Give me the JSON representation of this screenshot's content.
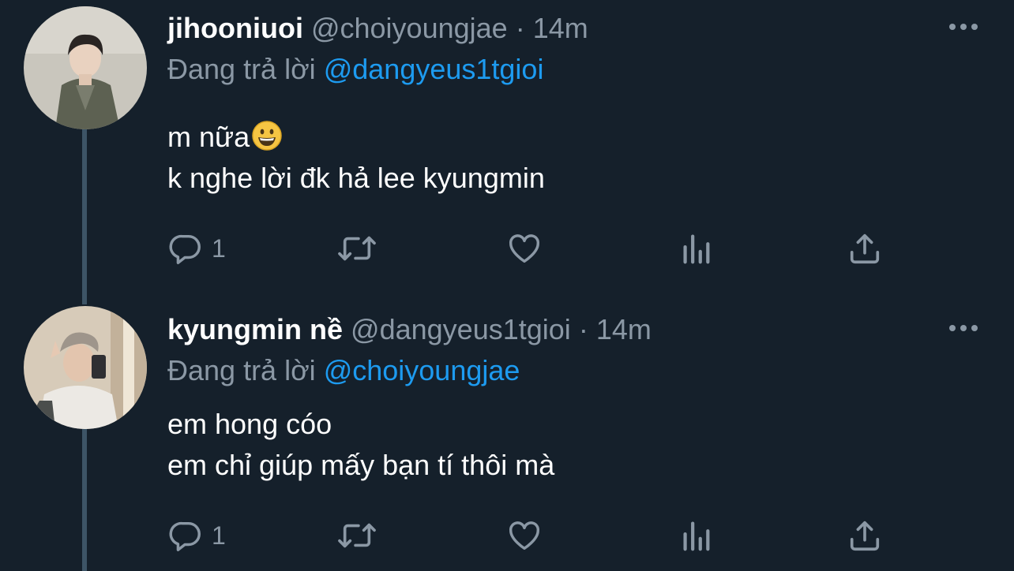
{
  "tweets": [
    {
      "name": "jihooniuoi",
      "handle": "@choiyoungjae",
      "separator": "·",
      "time": "14m",
      "replying_label": "Đang trả lời",
      "replying_to": "@dangyeus1tgioi",
      "body_lines": [
        "m nữa",
        "k nghe lời đk hả lee kyungmin"
      ],
      "reply_count": "1"
    },
    {
      "name": "kyungmin nề",
      "handle": "@dangyeus1tgioi",
      "separator": "·",
      "time": "14m",
      "replying_label": "Đang trả lời",
      "replying_to": "@choiyoungjae",
      "body_lines": [
        "em hong cóo",
        "em chỉ giúp mấy bạn tí thôi mà"
      ],
      "reply_count": "1"
    }
  ],
  "icons": {
    "reply": "reply-icon",
    "retweet": "retweet-icon",
    "like": "heart-icon",
    "analytics": "analytics-icon",
    "share": "share-icon",
    "more": "more-dots-icon",
    "emoji": "grinning-face-emoji"
  },
  "colors": {
    "background": "#15202b",
    "text": "#ffffff",
    "muted": "#8b98a5",
    "link": "#1d9bf0",
    "thread_line": "#3d5466"
  }
}
